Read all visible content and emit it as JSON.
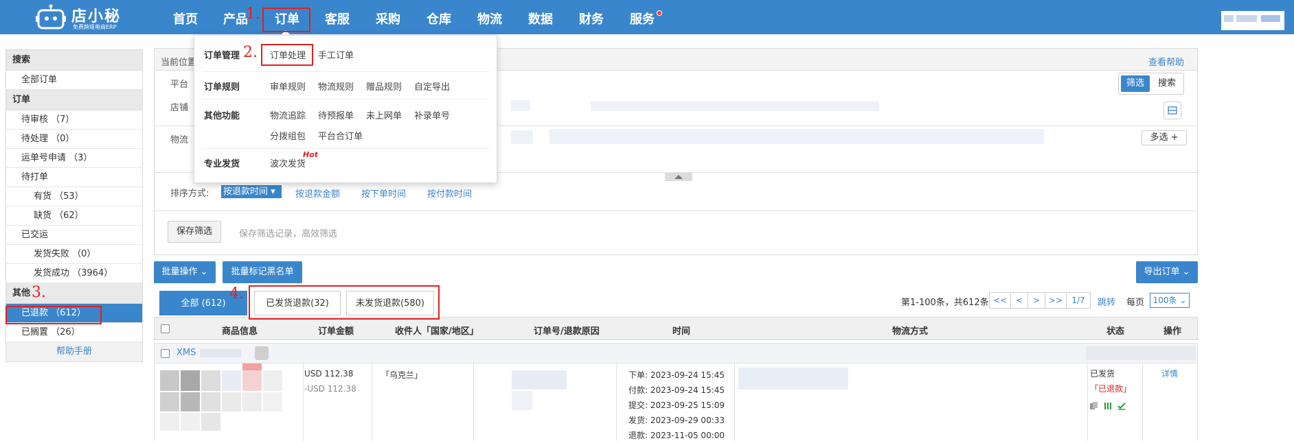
{
  "topbar": {
    "logo_title": "店小秘",
    "logo_subtitle": "免费跨境电商ERP",
    "nav": [
      "首页",
      "产品",
      "订单",
      "客服",
      "采购",
      "仓库",
      "物流",
      "数据",
      "财务",
      "服务"
    ]
  },
  "annotations": [
    "1.",
    "2.",
    "3.",
    "4."
  ],
  "dropdown": {
    "order_mgmt": {
      "heading": "订单管理",
      "links": [
        "订单处理",
        "手工订单"
      ]
    },
    "order_rules": {
      "heading": "订单规则",
      "links": [
        "审单规则",
        "物流规则",
        "赠品规则",
        "自定导出"
      ]
    },
    "other": {
      "heading": "其他功能",
      "links": [
        "物流追踪",
        "待预报单",
        "未上网单",
        "补录单号",
        "分拨组包",
        "平台合订单"
      ]
    },
    "pro": {
      "heading": "专业发货",
      "links": [
        "波次发货"
      ],
      "badge": "Hot"
    }
  },
  "sidebar": {
    "search_head": "搜索",
    "all_orders": "全部订单",
    "order_head": "订单",
    "pending_review": "待审核 （7）",
    "pending_process": "待处理 （0）",
    "waybill_apply": "运单号申请 （3）",
    "to_print": "待打单",
    "in_stock": "有货 （53）",
    "out_stock": "缺货 （62）",
    "shipped": "已交运",
    "ship_fail": "发货失败 （0）",
    "ship_ok": "发货成功 （3964）",
    "other_head": "其他",
    "refunded": "已退款 （612）",
    "shelved": "已搁置 （26）",
    "help": "帮助手册"
  },
  "panel": {
    "breadcrumb": "当前位置",
    "view_help": "查看帮助",
    "platform_label": "平台",
    "shop_label": "店铺",
    "logistics_label": "物流",
    "filter_btn": "筛选",
    "search_btn": "搜索",
    "multi_btn": "多选 +",
    "sort_label": "排序方式:",
    "sort_active": "按退款时间",
    "sort_options": [
      "按退款金额",
      "按下单时间",
      "按付款时间"
    ],
    "save_filter_btn": "保存筛选",
    "save_filter_hint": "保存筛选记录，高效筛选"
  },
  "actions": {
    "batch_ops": "批量操作",
    "batch_blacklist": "批量标记黑名单",
    "export": "导出订单"
  },
  "tabs": [
    "全部 (612)",
    "已发货退款(32)",
    "未发货退款(580)"
  ],
  "pagination": {
    "summary": "第1-100条，共612条",
    "buttons": [
      "<<",
      "<",
      ">",
      ">>"
    ],
    "page": "1/7",
    "jump": "跳转",
    "per_page_label": "每页",
    "per_page_value": "100条"
  },
  "table": {
    "headers": [
      "商品信息",
      "订单金额",
      "收件人「国家/地区」",
      "订单号/退款原因",
      "时间",
      "物流方式",
      "状态",
      "操作"
    ],
    "group_prefix": "XMS",
    "row": {
      "amount": "USD 112.38",
      "refund_amount": "-USD 112.38",
      "recipient_country": "「乌克兰」",
      "times": [
        {
          "label": "下单:",
          "value": "2023-09-24 15:45"
        },
        {
          "label": "付款:",
          "value": "2023-09-24 15:45"
        },
        {
          "label": "提交:",
          "value": "2023-09-25 15:09"
        },
        {
          "label": "发货:",
          "value": "2023-09-29 00:33"
        },
        {
          "label": "退款:",
          "value": "2023-11-05 00:00"
        }
      ],
      "status": "已发货",
      "status_refund": "「已退款」",
      "action": "详情"
    }
  },
  "colors": {
    "primary": "#3a86cc",
    "annotation": "#e02020"
  }
}
